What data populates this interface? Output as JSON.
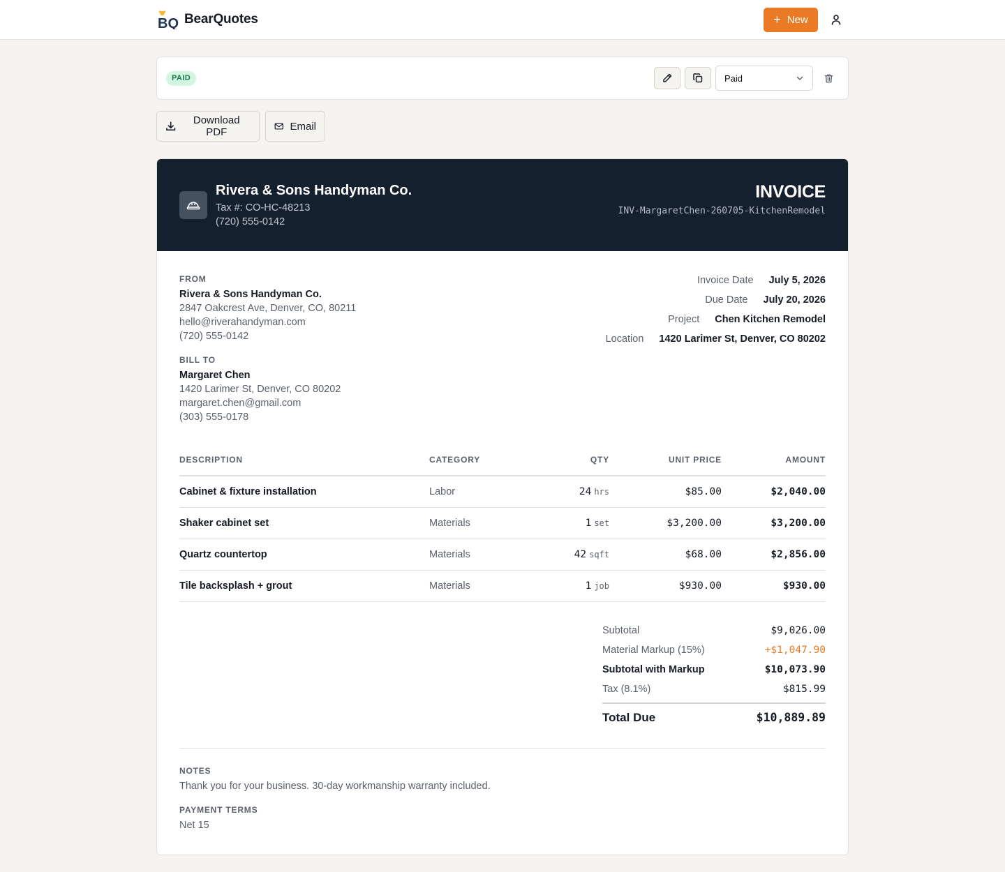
{
  "app": {
    "name": "BearQuotes",
    "logo_text": "BQ",
    "new_label": "New"
  },
  "status_bar": {
    "badge": "PAID",
    "status_value": "Paid",
    "badge_color": "#d3f5e2",
    "accent": "#ea7a23"
  },
  "actions": {
    "download_label": "Download PDF",
    "email_label": "Email"
  },
  "business": {
    "name": "Rivera & Sons Handyman Co.",
    "tax": "Tax #: CO-HC-48213",
    "phone": "(720) 555-0142"
  },
  "invoice": {
    "title": "INVOICE",
    "number": "INV-MargaretChen-260705-KitchenRemodel"
  },
  "from": {
    "label": "FROM",
    "name": "Rivera & Sons Handyman Co.",
    "address": "2847 Oakcrest Ave, Denver, CO, 80211",
    "email": "hello@riverahandyman.com",
    "phone": "(720) 555-0142"
  },
  "bill_to": {
    "label": "BILL TO",
    "name": "Margaret Chen",
    "address": "1420 Larimer St, Denver, CO 80202",
    "email": "margaret.chen@gmail.com",
    "phone": "(303) 555-0178"
  },
  "meta": [
    {
      "label": "Invoice Date",
      "value": "July 5, 2026"
    },
    {
      "label": "Due Date",
      "value": "July 20, 2026"
    },
    {
      "label": "Project",
      "value": "Chen Kitchen Remodel"
    },
    {
      "label": "Location",
      "value": "1420 Larimer St, Denver, CO 80202"
    }
  ],
  "table": {
    "headers": {
      "description": "DESCRIPTION",
      "category": "CATEGORY",
      "qty": "QTY",
      "unit_price": "UNIT PRICE",
      "amount": "AMOUNT"
    },
    "rows": [
      {
        "description": "Cabinet & fixture installation",
        "category": "Labor",
        "qty": "24",
        "unit": "hrs",
        "unit_price": "$85.00",
        "amount": "$2,040.00"
      },
      {
        "description": "Shaker cabinet set",
        "category": "Materials",
        "qty": "1",
        "unit": "set",
        "unit_price": "$3,200.00",
        "amount": "$3,200.00"
      },
      {
        "description": "Quartz countertop",
        "category": "Materials",
        "qty": "42",
        "unit": "sqft",
        "unit_price": "$68.00",
        "amount": "$2,856.00"
      },
      {
        "description": "Tile backsplash + grout",
        "category": "Materials",
        "qty": "1",
        "unit": "job",
        "unit_price": "$930.00",
        "amount": "$930.00"
      }
    ]
  },
  "totals": {
    "subtotal_label": "Subtotal",
    "subtotal": "$9,026.00",
    "markup_label": "Material Markup (15%)",
    "markup": "+$1,047.90",
    "markup_color": "#ea7a23",
    "subtotal_markup_label": "Subtotal with Markup",
    "subtotal_markup": "$10,073.90",
    "tax_label": "Tax (8.1%)",
    "tax": "$815.99",
    "total_label": "Total Due",
    "total": "$10,889.89"
  },
  "notes": {
    "label": "NOTES",
    "text": "Thank you for your business. 30-day workmanship warranty included.",
    "terms_label": "PAYMENT TERMS",
    "terms": "Net 15"
  }
}
